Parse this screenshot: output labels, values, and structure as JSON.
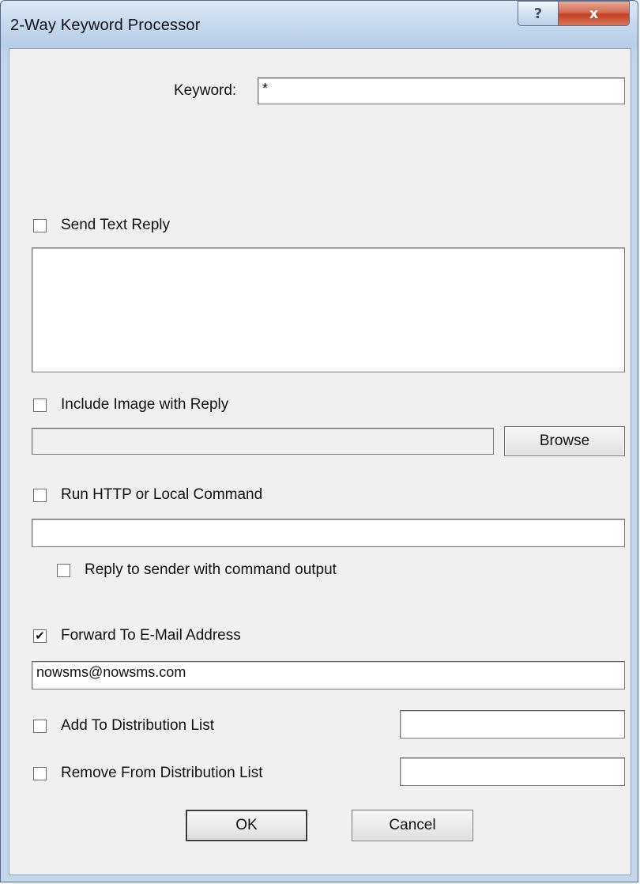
{
  "window": {
    "title": "2-Way Keyword Processor"
  },
  "titlebar": {
    "help_glyph": "?",
    "close_glyph": "x",
    "help_icon": "help-icon",
    "close_icon": "close-icon"
  },
  "keyword": {
    "label": "Keyword:",
    "value": "*"
  },
  "send_text_reply": {
    "label": "Send Text Reply",
    "checked": false,
    "text": ""
  },
  "include_image": {
    "label": "Include Image with Reply",
    "checked": false,
    "path": "",
    "browse_label": "Browse"
  },
  "run_command": {
    "label": "Run HTTP or Local Command",
    "checked": false,
    "command": "",
    "reply_label": "Reply to sender with command output",
    "reply_checked": false
  },
  "forward_email": {
    "label": "Forward To E-Mail Address",
    "checked": true,
    "check_glyph": "✔",
    "address": "nowsms@nowsms.com"
  },
  "add_list": {
    "label": "Add To Distribution List",
    "checked": false,
    "value": ""
  },
  "remove_list": {
    "label": "Remove From Distribution List",
    "checked": false,
    "value": ""
  },
  "buttons": {
    "ok": "OK",
    "cancel": "Cancel"
  }
}
